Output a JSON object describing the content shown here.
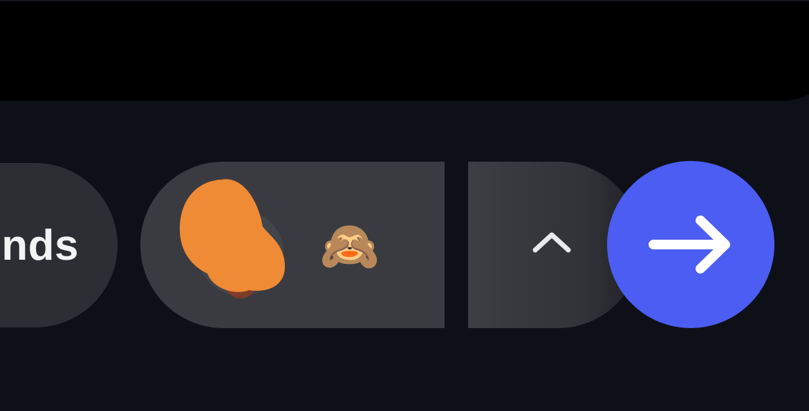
{
  "message_area": {
    "text": ""
  },
  "suggestions": {
    "left_pill_label": "nds",
    "reaction_emoji": "🙈",
    "reaction_emoji_alt": "🫣"
  },
  "icons": {
    "avatar": "avatar-redacted",
    "chevron": "chevron-up-icon",
    "send": "arrow-right-icon"
  },
  "colors": {
    "background": "#0d1017",
    "input_area": "#000000",
    "pill": "#393b40",
    "pill_left": "#2b2e33",
    "send_button": "#4b5df2",
    "redaction": "#ef8a35",
    "icon_light": "#f2f3f5"
  }
}
